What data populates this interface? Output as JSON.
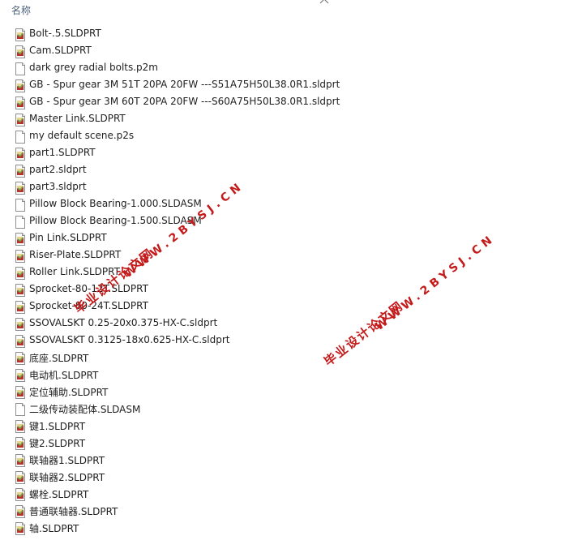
{
  "header": {
    "column_name": "名称",
    "sort_icon": "chevron-up-icon"
  },
  "files": [
    {
      "name": "Bolt-.5.SLDPRT",
      "icon": "solidworks-part-icon"
    },
    {
      "name": "Cam.SLDPRT",
      "icon": "solidworks-part-icon"
    },
    {
      "name": "dark grey radial bolts.p2m",
      "icon": "blank-file-icon"
    },
    {
      "name": "GB - Spur gear 3M 51T 20PA 20FW ---S51A75H50L38.0R1.sldprt",
      "icon": "solidworks-part-icon"
    },
    {
      "name": "GB - Spur gear 3M 60T 20PA 20FW ---S60A75H50L38.0R1.sldprt",
      "icon": "solidworks-part-icon"
    },
    {
      "name": "Master Link.SLDPRT",
      "icon": "solidworks-part-icon"
    },
    {
      "name": "my default scene.p2s",
      "icon": "blank-file-icon"
    },
    {
      "name": "part1.SLDPRT",
      "icon": "solidworks-part-icon"
    },
    {
      "name": "part2.sldprt",
      "icon": "solidworks-part-icon"
    },
    {
      "name": "part3.sldprt",
      "icon": "solidworks-part-icon"
    },
    {
      "name": "Pillow Block Bearing-1.000.SLDASM",
      "icon": "blank-file-icon"
    },
    {
      "name": "Pillow Block Bearing-1.500.SLDASM",
      "icon": "blank-file-icon"
    },
    {
      "name": "Pin Link.SLDPRT",
      "icon": "solidworks-part-icon"
    },
    {
      "name": "Riser-Plate.SLDPRT",
      "icon": "solidworks-part-icon"
    },
    {
      "name": "Roller Link.SLDPRT",
      "icon": "solidworks-part-icon"
    },
    {
      "name": "Sprocket-80-12T.SLDPRT",
      "icon": "solidworks-part-icon"
    },
    {
      "name": "Sprocket-80-24T.SLDPRT",
      "icon": "solidworks-part-icon"
    },
    {
      "name": "SSOVALSKT 0.25-20x0.375-HX-C.sldprt",
      "icon": "solidworks-part-icon"
    },
    {
      "name": "SSOVALSKT 0.3125-18x0.625-HX-C.sldprt",
      "icon": "solidworks-part-icon"
    },
    {
      "name": "底座.SLDPRT",
      "icon": "solidworks-part-icon"
    },
    {
      "name": "电动机.SLDPRT",
      "icon": "solidworks-part-icon"
    },
    {
      "name": "定位辅助.SLDPRT",
      "icon": "solidworks-part-icon"
    },
    {
      "name": "二级传动装配体.SLDASM",
      "icon": "blank-file-icon"
    },
    {
      "name": "键1.SLDPRT",
      "icon": "solidworks-part-icon"
    },
    {
      "name": "键2.SLDPRT",
      "icon": "solidworks-part-icon"
    },
    {
      "name": "联轴器1.SLDPRT",
      "icon": "solidworks-part-icon"
    },
    {
      "name": "联轴器2.SLDPRT",
      "icon": "solidworks-part-icon"
    },
    {
      "name": "螺栓.SLDPRT",
      "icon": "solidworks-part-icon"
    },
    {
      "name": "普通联轴器.SLDPRT",
      "icon": "solidworks-part-icon"
    },
    {
      "name": "轴.SLDPRT",
      "icon": "solidworks-part-icon"
    }
  ],
  "watermarks": [
    {
      "cn": "毕业设计论文网",
      "url": "WWW.2BYSJ.CN"
    },
    {
      "cn": "毕业设计论文网",
      "url": "WWW.2BYSJ.CN"
    }
  ],
  "colors": {
    "watermark": "#c41a1a",
    "header_text": "#4c607a"
  }
}
